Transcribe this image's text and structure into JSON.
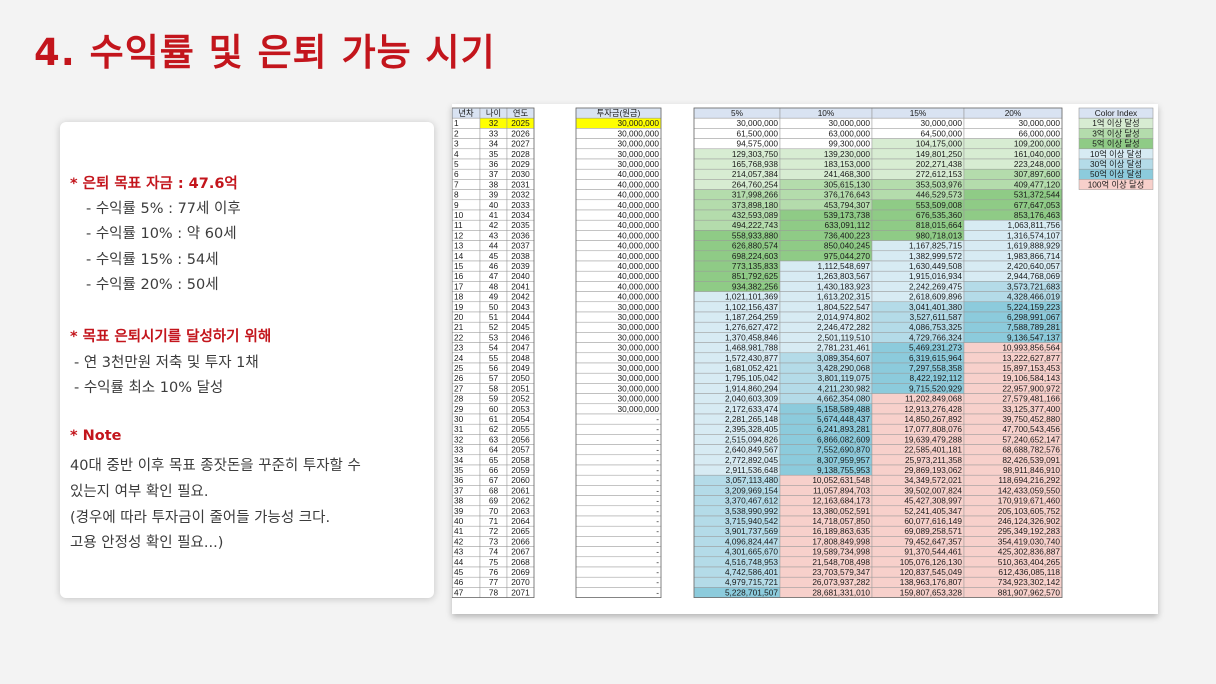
{
  "title": "4. 수익률 및 은퇴 가능 시기",
  "card": {
    "goal_heading": "* 은퇴 목표 자금 : 47.6억",
    "goal_items": [
      "- 수익률    5% : 77세 이후",
      "- 수익률 10% : 약 60세",
      "- 수익률 15% : 54세",
      "- 수익률 20% : 50세"
    ],
    "plan_heading": "* 목표 은퇴시기를 달성하기 위해",
    "plan_items": [
      "- 연 3천만원 저축 및 투자 1채",
      "- 수익률 최소 10% 달성"
    ],
    "note_heading": "* Note",
    "note_lines": [
      "40대 중반 이후 목표 종잣돈을 꾸준히 투자할 수",
      "있는지 여부 확인 필요.",
      "(경우에 따라 투자금이 줄어들 가능성 크다.",
      "고용 안정성 확인 필요...)"
    ]
  },
  "table": {
    "headers": [
      "년차",
      "나이",
      "연도",
      "투자금(원금)",
      "5%",
      "10%",
      "15%",
      "20%"
    ],
    "rows": [
      [
        "1",
        "32",
        "2025",
        "30,000,000",
        "30,000,000",
        "30,000,000",
        "30,000,000",
        "30,000,000"
      ],
      [
        "2",
        "33",
        "2026",
        "30,000,000",
        "61,500,000",
        "63,000,000",
        "64,500,000",
        "66,000,000"
      ],
      [
        "3",
        "34",
        "2027",
        "30,000,000",
        "94,575,000",
        "99,300,000",
        "104,175,000",
        "109,200,000"
      ],
      [
        "4",
        "35",
        "2028",
        "30,000,000",
        "129,303,750",
        "139,230,000",
        "149,801,250",
        "161,040,000"
      ],
      [
        "5",
        "36",
        "2029",
        "30,000,000",
        "165,768,938",
        "183,153,000",
        "202,271,438",
        "223,248,000"
      ],
      [
        "6",
        "37",
        "2030",
        "40,000,000",
        "214,057,384",
        "241,468,300",
        "272,612,153",
        "307,897,600"
      ],
      [
        "7",
        "38",
        "2031",
        "40,000,000",
        "264,760,254",
        "305,615,130",
        "353,503,976",
        "409,477,120"
      ],
      [
        "8",
        "39",
        "2032",
        "40,000,000",
        "317,998,266",
        "376,176,643",
        "446,529,573",
        "531,372,544"
      ],
      [
        "9",
        "40",
        "2033",
        "40,000,000",
        "373,898,180",
        "453,794,307",
        "553,509,008",
        "677,647,053"
      ],
      [
        "10",
        "41",
        "2034",
        "40,000,000",
        "432,593,089",
        "539,173,738",
        "676,535,360",
        "853,176,463"
      ],
      [
        "11",
        "42",
        "2035",
        "40,000,000",
        "494,222,743",
        "633,091,112",
        "818,015,664",
        "1,063,811,756"
      ],
      [
        "12",
        "43",
        "2036",
        "40,000,000",
        "558,933,880",
        "736,400,223",
        "980,718,013",
        "1,316,574,107"
      ],
      [
        "13",
        "44",
        "2037",
        "40,000,000",
        "626,880,574",
        "850,040,245",
        "1,167,825,715",
        "1,619,888,929"
      ],
      [
        "14",
        "45",
        "2038",
        "40,000,000",
        "698,224,603",
        "975,044,270",
        "1,382,999,572",
        "1,983,866,714"
      ],
      [
        "15",
        "46",
        "2039",
        "40,000,000",
        "773,135,833",
        "1,112,548,697",
        "1,630,449,508",
        "2,420,640,057"
      ],
      [
        "16",
        "47",
        "2040",
        "40,000,000",
        "851,792,625",
        "1,263,803,567",
        "1,915,016,934",
        "2,944,768,069"
      ],
      [
        "17",
        "48",
        "2041",
        "40,000,000",
        "934,382,256",
        "1,430,183,923",
        "2,242,269,475",
        "3,573,721,683"
      ],
      [
        "18",
        "49",
        "2042",
        "40,000,000",
        "1,021,101,369",
        "1,613,202,315",
        "2,618,609,896",
        "4,328,466,019"
      ],
      [
        "19",
        "50",
        "2043",
        "30,000,000",
        "1,102,156,437",
        "1,804,522,547",
        "3,041,401,380",
        "5,224,159,223"
      ],
      [
        "20",
        "51",
        "2044",
        "30,000,000",
        "1,187,264,259",
        "2,014,974,802",
        "3,527,611,587",
        "6,298,991,067"
      ],
      [
        "21",
        "52",
        "2045",
        "30,000,000",
        "1,276,627,472",
        "2,246,472,282",
        "4,086,753,325",
        "7,588,789,281"
      ],
      [
        "22",
        "53",
        "2046",
        "30,000,000",
        "1,370,458,846",
        "2,501,119,510",
        "4,729,766,324",
        "9,136,547,137"
      ],
      [
        "23",
        "54",
        "2047",
        "30,000,000",
        "1,468,981,788",
        "2,781,231,461",
        "5,469,231,273",
        "10,993,856,564"
      ],
      [
        "24",
        "55",
        "2048",
        "30,000,000",
        "1,572,430,877",
        "3,089,354,607",
        "6,319,615,964",
        "13,222,627,877"
      ],
      [
        "25",
        "56",
        "2049",
        "30,000,000",
        "1,681,052,421",
        "3,428,290,068",
        "7,297,558,358",
        "15,897,153,453"
      ],
      [
        "26",
        "57",
        "2050",
        "30,000,000",
        "1,795,105,042",
        "3,801,119,075",
        "8,422,192,112",
        "19,106,584,143"
      ],
      [
        "27",
        "58",
        "2051",
        "30,000,000",
        "1,914,860,294",
        "4,211,230,982",
        "9,715,520,929",
        "22,957,900,972"
      ],
      [
        "28",
        "59",
        "2052",
        "30,000,000",
        "2,040,603,309",
        "4,662,354,080",
        "11,202,849,068",
        "27,579,481,166"
      ],
      [
        "29",
        "60",
        "2053",
        "30,000,000",
        "2,172,633,474",
        "5,158,589,488",
        "12,913,276,428",
        "33,125,377,400"
      ],
      [
        "30",
        "61",
        "2054",
        "-",
        "2,281,265,148",
        "5,674,448,437",
        "14,850,267,892",
        "39,750,452,880"
      ],
      [
        "31",
        "62",
        "2055",
        "-",
        "2,395,328,405",
        "6,241,893,281",
        "17,077,808,076",
        "47,700,543,456"
      ],
      [
        "32",
        "63",
        "2056",
        "-",
        "2,515,094,826",
        "6,866,082,609",
        "19,639,479,288",
        "57,240,652,147"
      ],
      [
        "33",
        "64",
        "2057",
        "-",
        "2,640,849,567",
        "7,552,690,870",
        "22,585,401,181",
        "68,688,782,576"
      ],
      [
        "34",
        "65",
        "2058",
        "-",
        "2,772,892,045",
        "8,307,959,957",
        "25,973,211,358",
        "82,426,539,091"
      ],
      [
        "35",
        "66",
        "2059",
        "-",
        "2,911,536,648",
        "9,138,755,953",
        "29,869,193,062",
        "98,911,846,910"
      ],
      [
        "36",
        "67",
        "2060",
        "-",
        "3,057,113,480",
        "10,052,631,548",
        "34,349,572,021",
        "118,694,216,292"
      ],
      [
        "37",
        "68",
        "2061",
        "-",
        "3,209,969,154",
        "11,057,894,703",
        "39,502,007,824",
        "142,433,059,550"
      ],
      [
        "38",
        "69",
        "2062",
        "-",
        "3,370,467,612",
        "12,163,684,173",
        "45,427,308,997",
        "170,919,671,460"
      ],
      [
        "39",
        "70",
        "2063",
        "-",
        "3,538,990,992",
        "13,380,052,591",
        "52,241,405,347",
        "205,103,605,752"
      ],
      [
        "40",
        "71",
        "2064",
        "-",
        "3,715,940,542",
        "14,718,057,850",
        "60,077,616,149",
        "246,124,326,902"
      ],
      [
        "41",
        "72",
        "2065",
        "-",
        "3,901,737,569",
        "16,189,863,635",
        "69,089,258,571",
        "295,349,192,283"
      ],
      [
        "42",
        "73",
        "2066",
        "-",
        "4,096,824,447",
        "17,808,849,998",
        "79,452,647,357",
        "354,419,030,740"
      ],
      [
        "43",
        "74",
        "2067",
        "-",
        "4,301,665,670",
        "19,589,734,998",
        "91,370,544,461",
        "425,302,836,887"
      ],
      [
        "44",
        "75",
        "2068",
        "-",
        "4,516,748,953",
        "21,548,708,498",
        "105,076,126,130",
        "510,363,404,265"
      ],
      [
        "45",
        "76",
        "2069",
        "-",
        "4,742,586,401",
        "23,703,579,347",
        "120,837,545,049",
        "612,436,085,118"
      ],
      [
        "46",
        "77",
        "2070",
        "-",
        "4,979,715,721",
        "26,073,937,282",
        "138,963,176,807",
        "734,923,302,142"
      ],
      [
        "47",
        "78",
        "2071",
        "-",
        "5,228,701,507",
        "28,681,331,010",
        "159,807,653,328",
        "881,907,962,570"
      ]
    ],
    "color_index": {
      "title": "Color Index",
      "items": [
        {
          "label": "1억 이상 달성",
          "color": "#d7ecd2"
        },
        {
          "label": "3억 이상 달성",
          "color": "#b4dcac"
        },
        {
          "label": "5억 이상 달성",
          "color": "#8fcb86"
        },
        {
          "label": "10억 이상 달성",
          "color": "#d7ebf3"
        },
        {
          "label": "30억 이상 달성",
          "color": "#b4dbe8"
        },
        {
          "label": "50억 이상 달성",
          "color": "#8ccbdc"
        },
        {
          "label": "100억 이상 달성",
          "color": "#f7d0cb"
        }
      ]
    },
    "colors": {
      "header_fill": "#d9e3f2",
      "highlight_fill": "#ffff00",
      "grid": "#9a9a9a",
      "text": "#1a1a1a"
    }
  }
}
